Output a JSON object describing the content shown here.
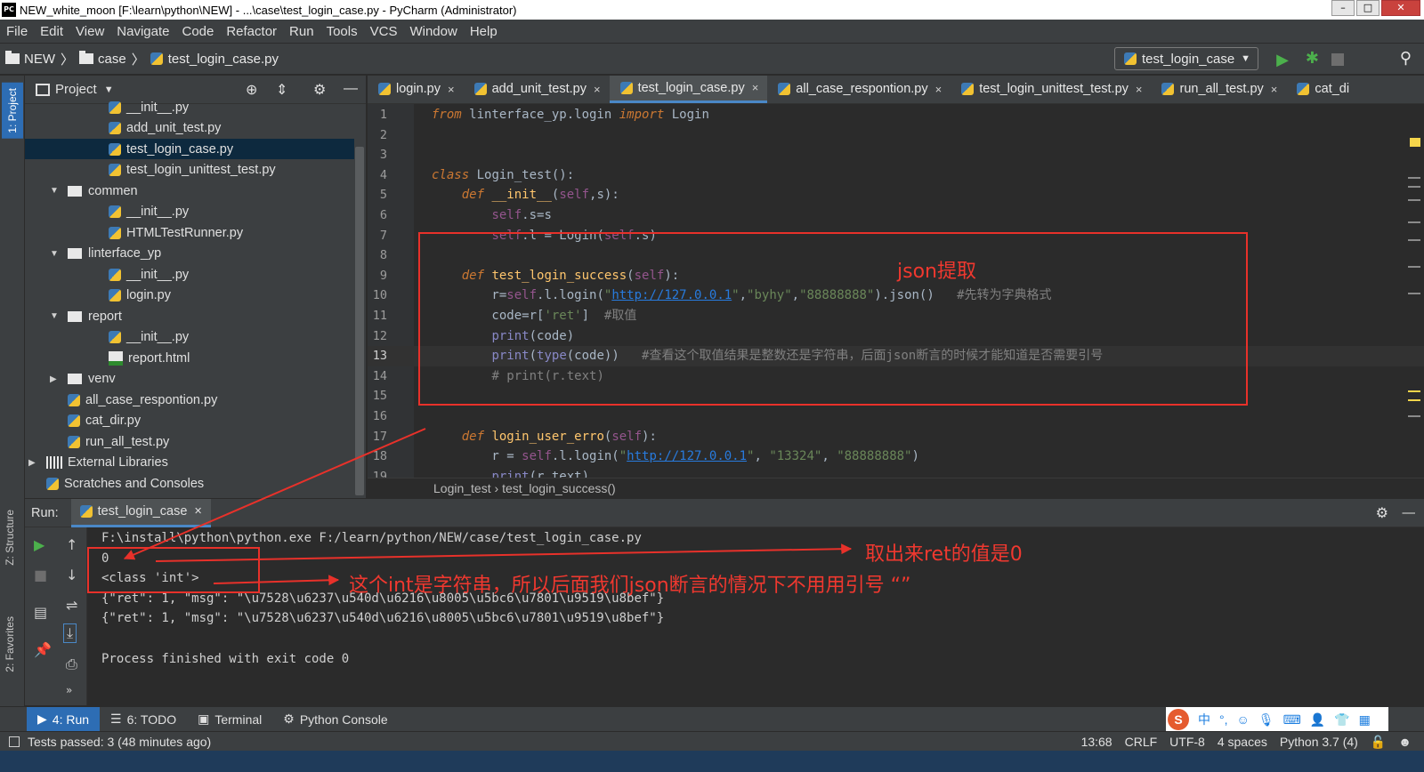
{
  "window": {
    "title": "NEW_white_moon [F:\\learn\\python\\NEW] - ...\\case\\test_login_case.py - PyCharm (Administrator)",
    "app_icon": "PC"
  },
  "menu": [
    "File",
    "Edit",
    "View",
    "Navigate",
    "Code",
    "Refactor",
    "Run",
    "Tools",
    "VCS",
    "Window",
    "Help"
  ],
  "navbar": {
    "crumbs": [
      "NEW",
      "case",
      "test_login_case.py"
    ],
    "run_config": "test_login_case"
  },
  "left_tools": {
    "project_tab": "1: Project",
    "structure_tab": "Z: Structure",
    "favorites_tab": "2: Favorites"
  },
  "project": {
    "title": "Project",
    "tree": [
      {
        "label": "__init__.py",
        "indent": 3,
        "icon": "python-file-icon"
      },
      {
        "label": "add_unit_test.py",
        "indent": 3,
        "icon": "python-file-icon"
      },
      {
        "label": "test_login_case.py",
        "indent": 3,
        "icon": "python-file-icon",
        "selected": true
      },
      {
        "label": "test_login_unittest_test.py",
        "indent": 3,
        "icon": "python-file-icon"
      },
      {
        "label": "commen",
        "indent": 2,
        "icon": "folder-icon",
        "arrow": "▼"
      },
      {
        "label": "__init__.py",
        "indent": 3,
        "icon": "python-file-icon"
      },
      {
        "label": "HTMLTestRunner.py",
        "indent": 3,
        "icon": "python-file-icon"
      },
      {
        "label": "linterface_yp",
        "indent": 2,
        "icon": "folder-icon",
        "arrow": "▼"
      },
      {
        "label": "__init__.py",
        "indent": 3,
        "icon": "python-file-icon"
      },
      {
        "label": "login.py",
        "indent": 3,
        "icon": "python-file-icon"
      },
      {
        "label": "report",
        "indent": 2,
        "icon": "folder-icon",
        "arrow": "▼"
      },
      {
        "label": "__init__.py",
        "indent": 3,
        "icon": "python-file-icon"
      },
      {
        "label": "report.html",
        "indent": 3,
        "icon": "html-file-icon"
      },
      {
        "label": "venv",
        "indent": 2,
        "icon": "folder-icon",
        "arrow": "▶"
      },
      {
        "label": "all_case_respontion.py",
        "indent": 2,
        "icon": "python-file-icon"
      },
      {
        "label": "cat_dir.py",
        "indent": 2,
        "icon": "python-file-icon"
      },
      {
        "label": "run_all_test.py",
        "indent": 2,
        "icon": "python-file-icon"
      },
      {
        "label": "External Libraries",
        "indent": 1,
        "icon": "library-icon",
        "arrow": "▶"
      },
      {
        "label": "Scratches and Consoles",
        "indent": 1,
        "icon": "scratches-icon"
      }
    ]
  },
  "editor": {
    "tabs": [
      {
        "label": "login.py",
        "close": "×"
      },
      {
        "label": "add_unit_test.py",
        "close": "×"
      },
      {
        "label": "test_login_case.py",
        "close": "×",
        "active": true
      },
      {
        "label": "all_case_respontion.py",
        "close": "×"
      },
      {
        "label": "test_login_unittest_test.py",
        "close": "×"
      },
      {
        "label": "run_all_test.py",
        "close": "×"
      },
      {
        "label": "cat_di",
        "close": ""
      }
    ],
    "line_numbers": [
      "1",
      "2",
      "3",
      "4",
      "5",
      "6",
      "7",
      "8",
      "9",
      "10",
      "11",
      "12",
      "13",
      "14",
      "15",
      "16",
      "17",
      "18",
      "19"
    ],
    "current_line": 13,
    "breadcrumb": [
      "Login_test",
      "test_login_success()"
    ]
  },
  "run": {
    "label": "Run:",
    "tab": "test_login_case",
    "tab_close": "×",
    "console": [
      "F:\\install\\python\\python.exe F:/learn/python/NEW/case/test_login_case.py",
      "0",
      "<class 'int'>",
      "{\"ret\": 1, \"msg\": \"\\u7528\\u6237\\u540d\\u6216\\u8005\\u5bc6\\u7801\\u9519\\u8bef\"}",
      "{\"ret\": 1, \"msg\": \"\\u7528\\u6237\\u540d\\u6216\\u8005\\u5bc6\\u7801\\u9519\\u8bef\"}",
      "",
      "Process finished with exit code 0"
    ]
  },
  "bottom_tabs": [
    "4: Run",
    "6: TODO",
    "Terminal",
    "Python Console"
  ],
  "status": {
    "message": "Tests passed: 3 (48 minutes ago)",
    "position": "13:68",
    "line_sep": "CRLF",
    "encoding": "UTF-8",
    "indent": "4 spaces",
    "interpreter": "Python 3.7 (4)"
  },
  "ime": {
    "logo": "S",
    "mode": "中"
  },
  "annotations": {
    "json_extract": "json提取",
    "ret_value": "取出来ret的值是0",
    "int_note": "这个int是字符串，所以后面我们json断言的情况下不用用引号 “”"
  },
  "colors": {
    "annotation": "#e8312a",
    "accent": "#2d6db4",
    "tab_underline": "#4a88c7"
  }
}
